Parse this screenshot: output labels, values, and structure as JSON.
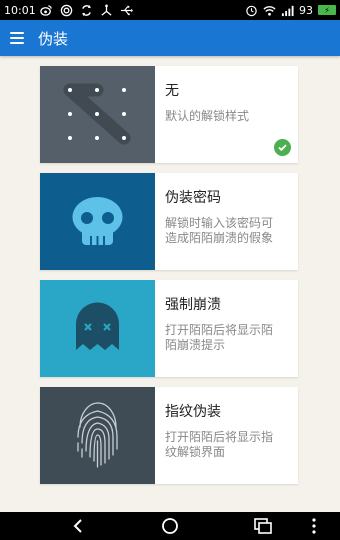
{
  "status_bar": {
    "time": "10:01",
    "battery": "93",
    "icons": [
      "weibo-icon",
      "app-icon",
      "sync-icon",
      "network-icon",
      "usb-icon",
      "alarm-icon",
      "wifi-icon",
      "signal-icon",
      "battery-icon"
    ]
  },
  "app_bar": {
    "title": "伪装",
    "menu_icon": "menu-icon"
  },
  "options": [
    {
      "title": "无",
      "description": "默认的解锁样式",
      "icon": "pattern-lock-icon",
      "selected": true,
      "thumb_color": "#545f69"
    },
    {
      "title": "伪装密码",
      "description": "解锁时输入该密码可造成陌陌崩溃的假象",
      "icon": "skull-icon",
      "selected": false,
      "thumb_color": "#0d5e8f"
    },
    {
      "title": "强制崩溃",
      "description": "打开陌陌后将显示陌陌崩溃提示",
      "icon": "ghost-icon",
      "selected": false,
      "thumb_color": "#2aa6c7"
    },
    {
      "title": "指纹伪装",
      "description": "打开陌陌后将显示指纹解锁界面",
      "icon": "fingerprint-icon",
      "selected": false,
      "thumb_color": "#3f4b55"
    }
  ],
  "nav_bar": {
    "buttons": [
      "back-icon",
      "home-icon",
      "recents-icon",
      "more-icon"
    ]
  },
  "colors": {
    "app_bar": "#1976d2",
    "check": "#4caf50",
    "background": "#f5f2ec"
  }
}
